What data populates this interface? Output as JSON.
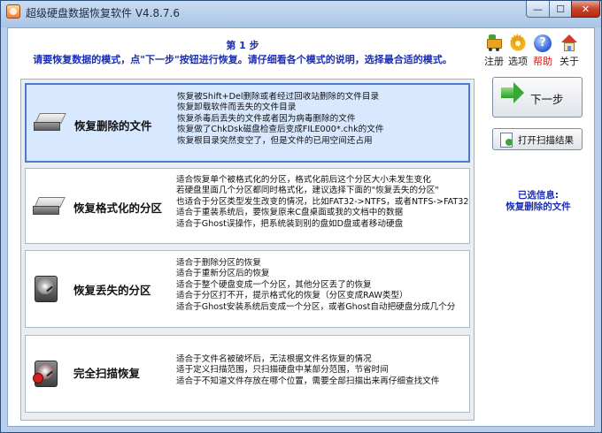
{
  "window": {
    "title": "超级硬盘数据恢复软件 V4.8.7.6",
    "controls": {
      "minimize": "—",
      "maximize": "☐",
      "close": "✕"
    }
  },
  "header": {
    "step": "第 1 步",
    "instruction": "请要恢复数据的模式，点\"下一步\"按钮进行恢复。请仔细看各个模式的说明，选择最合适的模式。"
  },
  "toolbar": [
    {
      "label": "注册",
      "icon": "cart-icon",
      "highlight": false
    },
    {
      "label": "选项",
      "icon": "gear-icon",
      "highlight": false
    },
    {
      "label": "帮助",
      "icon": "help-icon",
      "highlight": true
    },
    {
      "label": "关于",
      "icon": "house-icon",
      "highlight": false
    }
  ],
  "modes": [
    {
      "name": "恢复删除的文件",
      "selected": true,
      "icon": "drive-icon",
      "lines": [
        "恢复被Shift+Del删除或者经过回收站删除的文件目录",
        "恢复卸载软件而丢失的文件目录",
        "恢复杀毒后丢失的文件或者因为病毒删除的文件",
        "恢复做了ChkDsk磁盘检查后变成FILE000*.chk的文件",
        "恢复根目录突然变空了，但是文件的已用空间还占用"
      ]
    },
    {
      "name": "恢复格式化的分区",
      "selected": false,
      "icon": "drive-icon",
      "lines": [
        "适合恢复单个被格式化的分区，格式化前后这个分区大小未发生变化",
        "若硬盘里面几个分区都同时格式化，建议选择下面的\"恢复丢失的分区\"",
        "也适合于分区类型发生改变的情况，比如FAT32->NTFS，或者NTFS->FAT32",
        "适合于重装系统后，要恢复原来C盘桌面或我的文档中的数据",
        "适合于Ghost误操作，把系统装到别的盘如D盘或者移动硬盘"
      ]
    },
    {
      "name": "恢复丢失的分区",
      "selected": false,
      "icon": "hdd-icon",
      "lines": [
        "适合于删除分区的恢复",
        "适合于重新分区后的恢复",
        "适合于整个硬盘变成一个分区，其他分区丢了的恢复",
        "适合于分区打不开，提示格式化的恢复（分区变成RAW类型）",
        "适合于Ghost安装系统后变成一个分区，或者Ghost自动把硬盘分成几个分"
      ]
    },
    {
      "name": "完全扫描恢复",
      "selected": false,
      "icon": "hdd-scan-icon",
      "lines": [
        "适合于文件名被破坏后，无法根据文件名恢复的情况",
        "适于定义扫描范围，只扫描硬盘中某部分范围，节省时间",
        "适合于不知道文件存放在哪个位置，需要全部扫描出来再仔细查找文件"
      ]
    }
  ],
  "buttons": {
    "next": "下一步",
    "open_scan": "打开扫描结果"
  },
  "selection_info": {
    "label": "已选信息:",
    "value": "恢复删除的文件"
  }
}
